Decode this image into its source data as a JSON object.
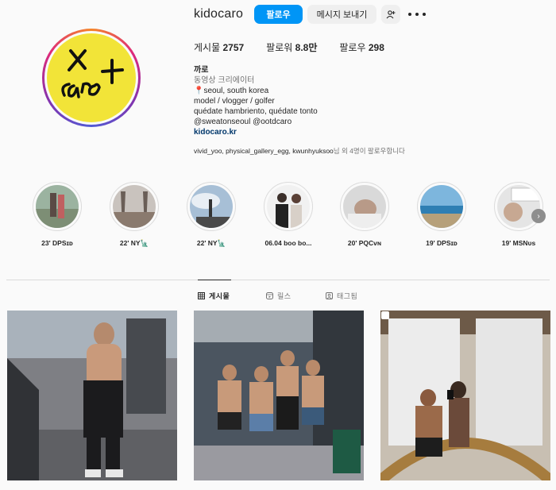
{
  "profile": {
    "username": "kidocaro",
    "follow_label": "팔로우",
    "message_label": "메시지 보내기",
    "add_user_icon": "add-user-icon",
    "more_icon": "more-icon",
    "stats": [
      {
        "label": "게시물",
        "value": "2757"
      },
      {
        "label": "팔로워",
        "value": "8.8만"
      },
      {
        "label": "팔로우",
        "value": "298"
      }
    ],
    "name": "까로",
    "category": "동영상 크리에이터",
    "bio_lines": [
      "seoul, south korea",
      "model / vlogger / golfer",
      "quédate hambriento, quédate tonto",
      "@sweatonseoul @ootdcaro"
    ],
    "link": "kidocaro.kr",
    "followed_by_names": "vivid_yoo, physical_gallery_egg, kwunhyuksoo",
    "followed_by_suffix": "님 외 4명이 팔로우합니다",
    "avatar_text": "caro"
  },
  "highlights": [
    {
      "label": "23' DPSɪᴅ"
    },
    {
      "label": "22' NY🗽"
    },
    {
      "label": "22' NY🗽"
    },
    {
      "label": "06.04 boo bo..."
    },
    {
      "label": "20' PQCᴠɴ"
    },
    {
      "label": "19' DPSɪᴅ"
    },
    {
      "label": "19' MSNᴜs"
    }
  ],
  "tabs": [
    {
      "label": "게시물",
      "icon": "grid-icon",
      "active": true
    },
    {
      "label": "릴스",
      "icon": "reels-icon",
      "active": false
    },
    {
      "label": "태그됨",
      "icon": "tagged-icon",
      "active": false
    }
  ],
  "colors": {
    "accent": "#0095f6",
    "avatar_bg": "#f2e438"
  }
}
